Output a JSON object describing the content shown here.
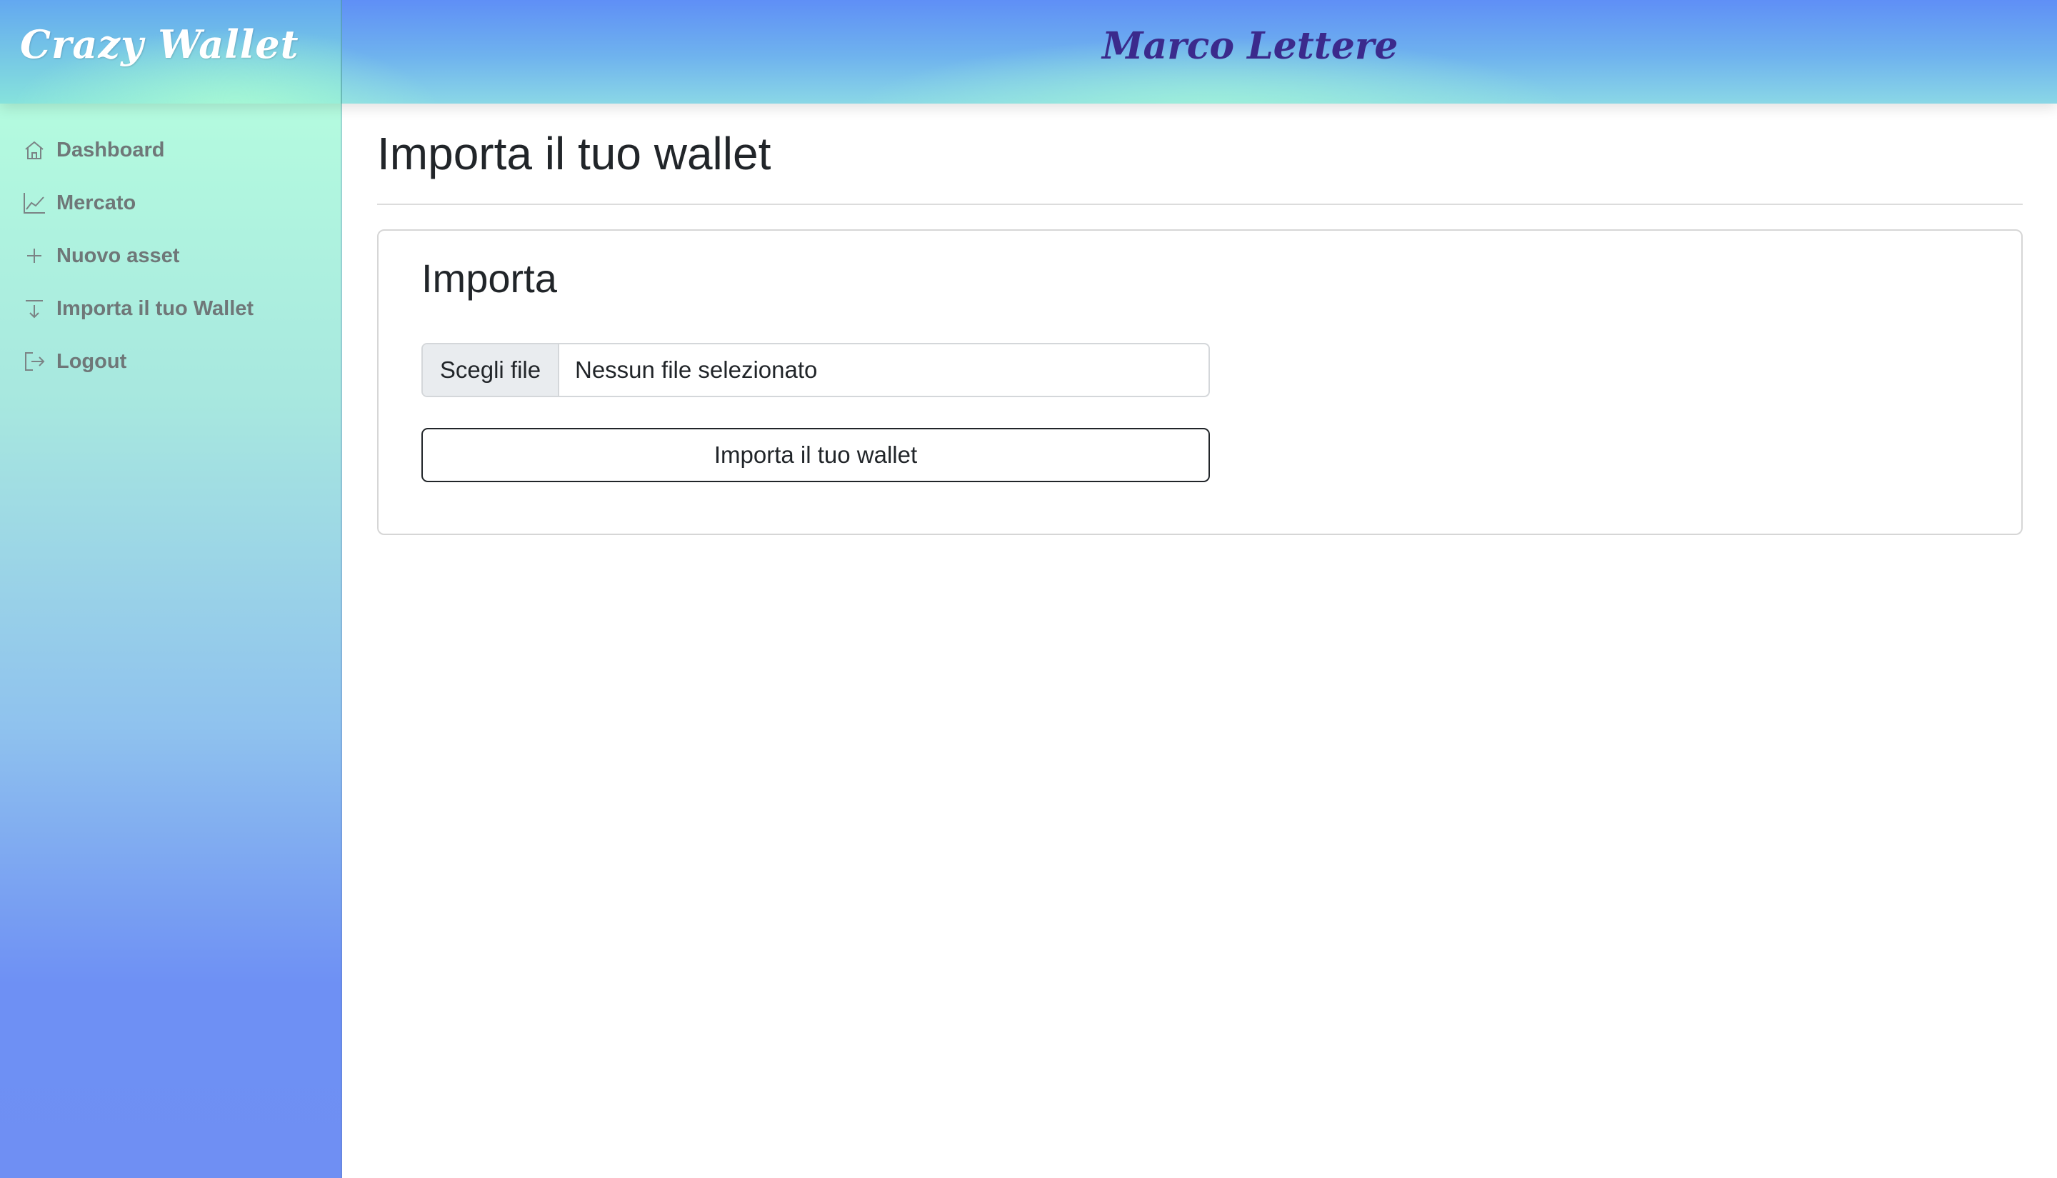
{
  "header": {
    "brand": "Crazy Wallet",
    "user_name": "Marco Lettere"
  },
  "sidebar": {
    "items": [
      {
        "label": "Dashboard",
        "icon": "home-icon"
      },
      {
        "label": "Mercato",
        "icon": "chart-line-icon"
      },
      {
        "label": "Nuovo asset",
        "icon": "plus-icon"
      },
      {
        "label": "Importa il tuo Wallet",
        "icon": "import-download-icon"
      },
      {
        "label": "Logout",
        "icon": "logout-icon"
      }
    ]
  },
  "main": {
    "page_title": "Importa il tuo wallet",
    "card": {
      "title": "Importa",
      "file_button_label": "Scegli file",
      "file_status": "Nessun file selezionato",
      "submit_label": "Importa il tuo wallet"
    }
  },
  "colors": {
    "sidebar_text": "#6f7778",
    "username_text": "#3b2a8c",
    "brand_text": "#ffffff"
  }
}
